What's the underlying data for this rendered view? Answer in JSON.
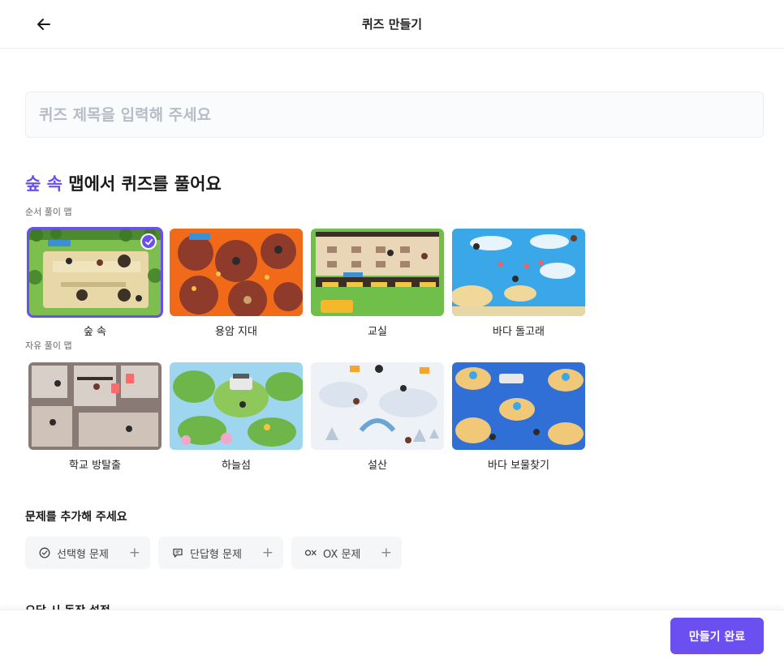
{
  "header": {
    "title": "퀴즈 만들기"
  },
  "title_input": {
    "placeholder": "퀴즈 제목을 입력해 주세요",
    "value": ""
  },
  "map_section": {
    "heading_accent": "숲 속",
    "heading_rest": " 맵에서 퀴즈를 풀어요",
    "ordered_group_label": "순서 풀이 맵",
    "free_group_label": "자유 풀이 맵",
    "ordered_maps": [
      {
        "name": "숲 속",
        "selected": true
      },
      {
        "name": "용암 지대",
        "selected": false
      },
      {
        "name": "교실",
        "selected": false
      },
      {
        "name": "바다 돌고래",
        "selected": false
      }
    ],
    "free_maps": [
      {
        "name": "학교 방탈출",
        "selected": false
      },
      {
        "name": "하늘섬",
        "selected": false
      },
      {
        "name": "설산",
        "selected": false
      },
      {
        "name": "바다 보물찾기",
        "selected": false
      }
    ]
  },
  "add_questions": {
    "heading": "문제를 추가해 주세요",
    "chips": [
      {
        "label": "선택형 문제",
        "icon": "check-circle-icon"
      },
      {
        "label": "단답형 문제",
        "icon": "speech-bubble-icon"
      },
      {
        "label": "OX 문제",
        "icon": "ox-icon"
      }
    ],
    "plus_symbol": "+"
  },
  "peek_text": "오답 시 동작 설정",
  "footer": {
    "submit_label": "만들기 완료"
  },
  "colors": {
    "accent": "#6b4ff0",
    "placeholder": "#b8bcc6",
    "chip_bg": "#f5f6f8"
  }
}
